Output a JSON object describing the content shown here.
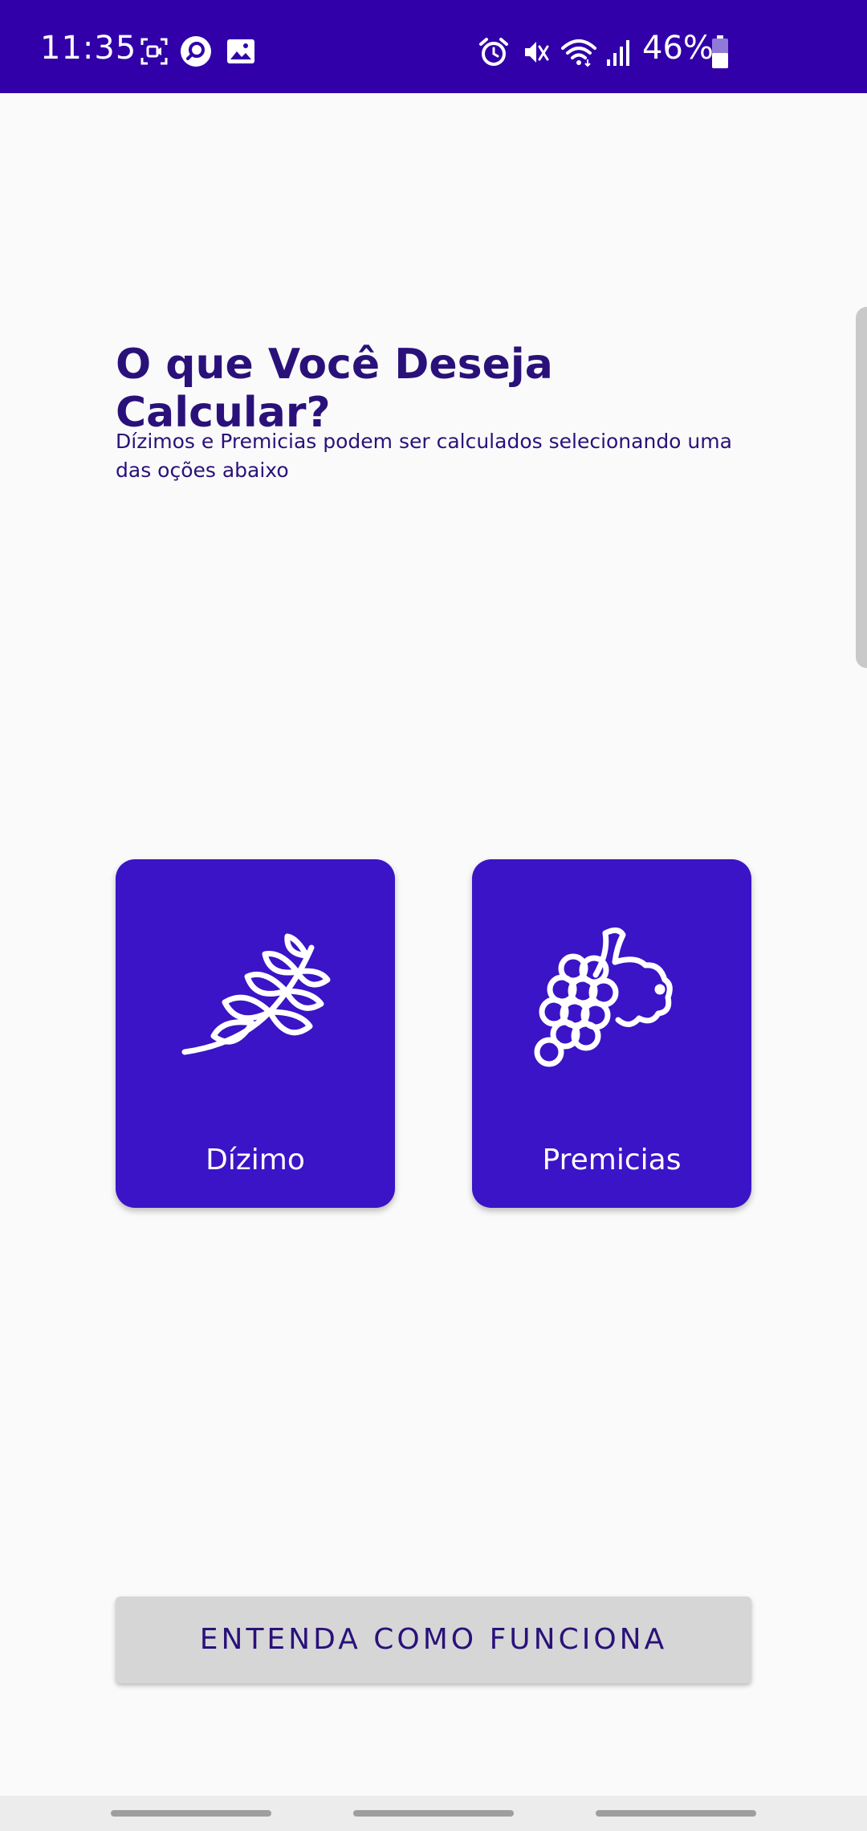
{
  "status_bar": {
    "time": "11:35",
    "battery_percent": "46%",
    "background_color": "#3100a9",
    "icons_left": [
      "screen-record-icon",
      "search-app-icon",
      "gallery-icon"
    ],
    "icons_right": [
      "alarm-icon",
      "mute-icon",
      "wifi-icon",
      "signal-icon",
      "battery-icon"
    ]
  },
  "main": {
    "title": "O que Você Deseja Calcular?",
    "subtitle": "Dízimos e Premicias podem ser calculados selecionando uma das oções abaixo"
  },
  "options": [
    {
      "label": "Dízimo",
      "icon": "wheat-icon"
    },
    {
      "label": "Premicias",
      "icon": "grapes-icon"
    }
  ],
  "help_button": {
    "label": "ENTENDA COMO FUNCIONA"
  },
  "colors": {
    "accent": "#3a14c6",
    "text": "#2a117a",
    "background": "#fafafa",
    "button_gray": "#d6d6d6"
  }
}
